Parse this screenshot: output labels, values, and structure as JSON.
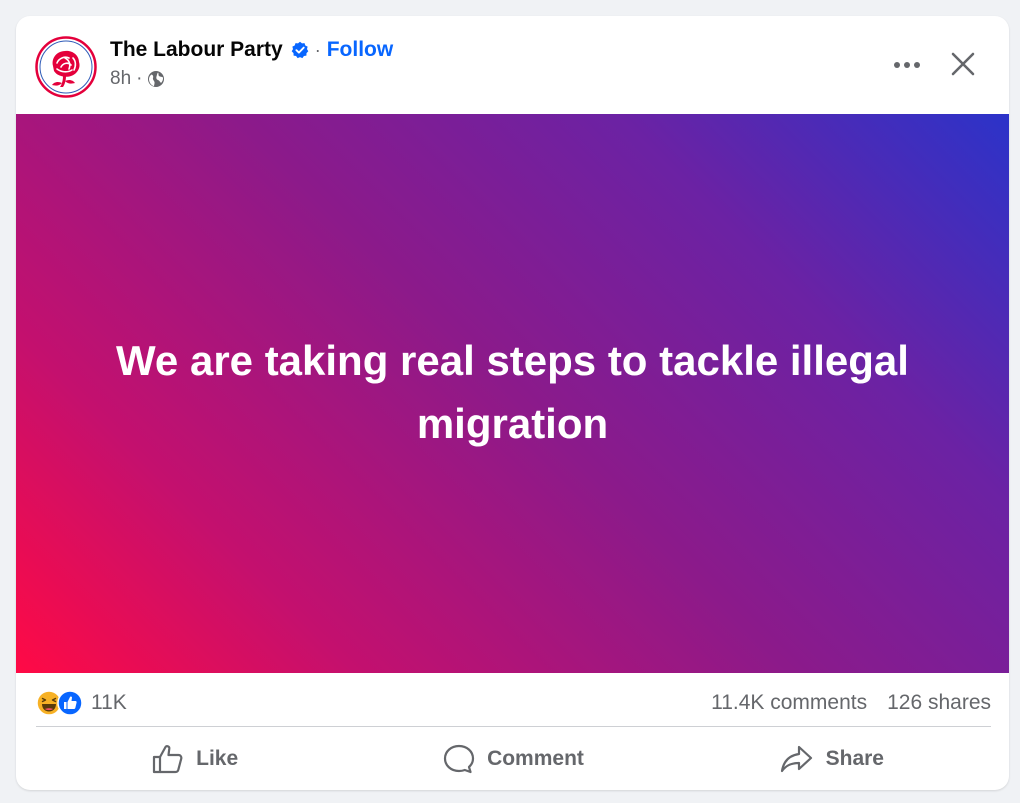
{
  "post": {
    "author": "The Labour Party",
    "follow_label": "Follow",
    "separator": "·",
    "time": "8h",
    "audience_icon": "globe-icon",
    "text": "We are taking real steps to tackle illegal migration",
    "background_gradient": [
      "#ff0a45",
      "#8c1a8a",
      "#2b33c9"
    ]
  },
  "stats": {
    "reactions_count": "11K",
    "reaction_icons": [
      "haha-icon",
      "like-icon"
    ],
    "comments": "11.4K comments",
    "shares": "126 shares"
  },
  "actions": {
    "like": "Like",
    "comment": "Comment",
    "share": "Share"
  },
  "colors": {
    "follow_blue": "#0866ff",
    "muted": "#65676b",
    "logo_red": "#e4003b"
  }
}
